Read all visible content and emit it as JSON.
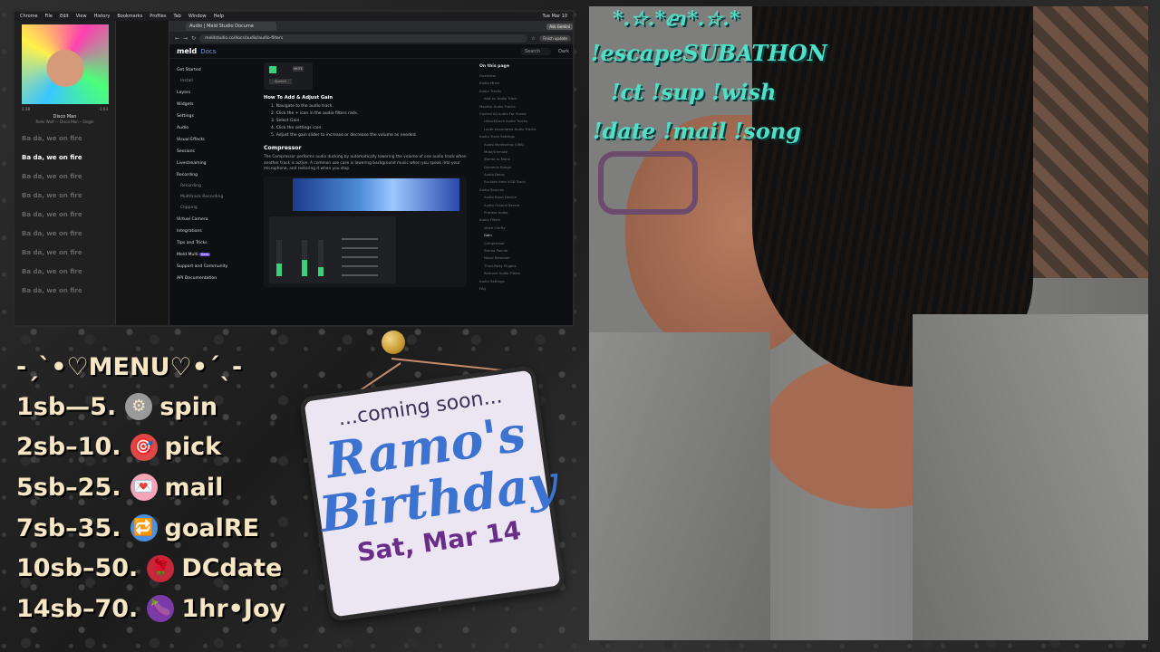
{
  "screen": {
    "menubar": [
      "Chrome",
      "File",
      "Edit",
      "View",
      "History",
      "Bookmarks",
      "Profiles",
      "Tab",
      "Window",
      "Help"
    ],
    "clock": "Tue Mar 10",
    "music": {
      "time_elapsed": "2:38",
      "time_remaining": "-1:03",
      "track_title": "Disco Man",
      "track_artist": "Remi Wolf — Disco Man – Single",
      "lyrics": [
        "Ba da, we on fire",
        "Ba da, we on fire",
        "Ba da, we on fire",
        "Ba da, we on fire",
        "Ba da, we on fire",
        "Ba da, we on fire",
        "Ba da, we on fire",
        "Ba da, we on fire",
        "Ba da, we on fire"
      ]
    },
    "browser": {
      "tab_title": "Audio | Meld Studio Docume",
      "ask_button": "Ask Gemini",
      "url": "meldstudio.co/docs/audio/audio-filters",
      "finish_button": "Finish update",
      "logo": "meld",
      "logo_docs": "Docs",
      "search_placeholder": "Search",
      "theme": "Dark",
      "nav": [
        {
          "label": "Get Started",
          "sub": false
        },
        {
          "label": "Install",
          "sub": true
        },
        {
          "label": "Layers",
          "sub": false
        },
        {
          "label": "Widgets",
          "sub": false
        },
        {
          "label": "Settings",
          "sub": false
        },
        {
          "label": "Audio",
          "sub": false
        },
        {
          "label": "Visual Effects",
          "sub": false
        },
        {
          "label": "Sessions",
          "sub": false
        },
        {
          "label": "Livestreaming",
          "sub": false
        },
        {
          "label": "Recording",
          "sub": false
        },
        {
          "label": "Recording",
          "sub": true
        },
        {
          "label": "Multitrack Recording",
          "sub": true
        },
        {
          "label": "Clipping",
          "sub": true
        },
        {
          "label": "Virtual Camera",
          "sub": false
        },
        {
          "label": "Integrations",
          "sub": false
        },
        {
          "label": "Tips and Tricks",
          "sub": false
        },
        {
          "label": "Meld Multi",
          "sub": false,
          "badge": "Beta"
        },
        {
          "label": "Support and Community",
          "sub": false
        },
        {
          "label": "API Documentation",
          "sub": false
        }
      ],
      "main": {
        "mute_label": "MUTE",
        "speech_label": "Speech",
        "gain_heading": "How To Add & Adjust Gain",
        "steps": [
          "1. Navigate to the audio track.",
          "2. Click the + icon in the audio filters rack.",
          "3. Select Gain.",
          "4. Click the settings icon.",
          "5. Adjust the gain slider to increase or decrease the volume as needed."
        ],
        "compressor_heading": "Compressor",
        "compressor_text": "The Compressor performs audio ducking by automatically lowering the volume of one audio track when another track is active. A common use case is lowering background music when you speak into your microphone, and restoring it when you stop."
      },
      "toc_title": "On this page",
      "toc": [
        {
          "label": "Overview",
          "sub": false
        },
        {
          "label": "Audio Mixer",
          "sub": false
        },
        {
          "label": "Audio Tracks",
          "sub": false
        },
        {
          "label": "Add an Audio Track",
          "sub": true
        },
        {
          "label": "Monitor Audio Tracks",
          "sub": false
        },
        {
          "label": "Control All Audio For Scene",
          "sub": false
        },
        {
          "label": "Unlock/Lock Audio Tracks",
          "sub": true
        },
        {
          "label": "Layer Associated Audio Tracks",
          "sub": true
        },
        {
          "label": "Audio Track Settings",
          "sub": false
        },
        {
          "label": "Audio Monitoring (OBS)",
          "sub": true
        },
        {
          "label": "Mute/Unmute",
          "sub": true
        },
        {
          "label": "Stereo to Mono",
          "sub": true
        },
        {
          "label": "Dynamic Range",
          "sub": true
        },
        {
          "label": "Audio Delay",
          "sub": true
        },
        {
          "label": "Exclude from VOD Track",
          "sub": true
        },
        {
          "label": "Audio Sources",
          "sub": false
        },
        {
          "label": "Audio Input Device",
          "sub": true
        },
        {
          "label": "Audio Output Device",
          "sub": true
        },
        {
          "label": "Process Audio",
          "sub": true
        },
        {
          "label": "Audio Filters",
          "sub": false
        },
        {
          "label": "Voice Clarity",
          "sub": true
        },
        {
          "label": "Gain",
          "sub": true,
          "active": true
        },
        {
          "label": "Compressor",
          "sub": true
        },
        {
          "label": "Stereo Panner",
          "sub": true
        },
        {
          "label": "Noise Remover",
          "sub": true
        },
        {
          "label": "Third-Party Plugins",
          "sub": true
        },
        {
          "label": "Remove Audio Filters",
          "sub": true
        },
        {
          "label": "Audio Settings",
          "sub": false
        },
        {
          "label": "FAQ",
          "sub": false
        }
      ]
    }
  },
  "menu": {
    "title": "-ˏˋ•♡MENU♡•ˊˎ-",
    "items": [
      {
        "code": "1sb—5.",
        "emoji": "⚙",
        "emoji_name": "gear-icon",
        "label": "spin",
        "emoji_color": "#9a9a9a"
      },
      {
        "code": "2sb–10.",
        "emoji": "🎯",
        "emoji_name": "target-icon",
        "label": "pick",
        "emoji_color": "#e04848"
      },
      {
        "code": "5sb–25.",
        "emoji": "💌",
        "emoji_name": "love-letter-icon",
        "label": "mail",
        "emoji_color": "#f4a6b8"
      },
      {
        "code": "7sb–35.",
        "emoji": "🔁",
        "emoji_name": "repeat-icon",
        "label": "goalRE",
        "emoji_color": "#4a8fe0"
      },
      {
        "code": "10sb–50.",
        "emoji": "🌹",
        "emoji_name": "rose-icon",
        "label": "DCdate",
        "emoji_color": "#c4283a"
      },
      {
        "code": "14sb–70.",
        "emoji": "🍆",
        "emoji_name": "eggplant-icon",
        "label": "1hr•Joy",
        "emoji_color": "#7a3aa8"
      }
    ]
  },
  "sign": {
    "coming_soon": "...coming soon...",
    "name_line1": "Ramo's",
    "name_line2": "Birthday",
    "date": "Sat, Mar 14"
  },
  "commands": {
    "deco": "*.☆.*ⅇɿ*.☆.*",
    "line1": "!escapeSUBATHON",
    "line2": "!ct !sup !wish",
    "line3": "!date !mail !song"
  }
}
